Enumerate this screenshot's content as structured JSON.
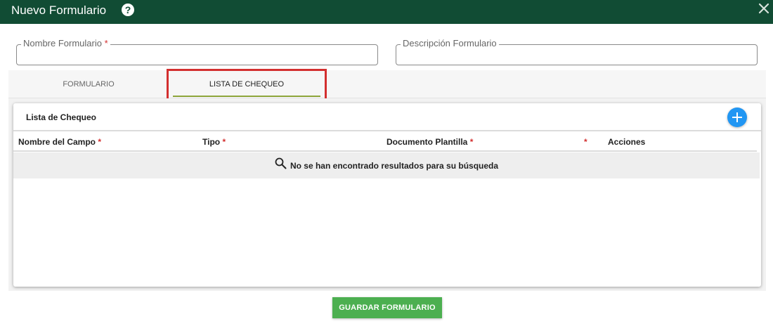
{
  "window": {
    "title": "Nuevo Formulario",
    "help_icon": "help-icon",
    "close_icon": "close-icon"
  },
  "form": {
    "name_field": {
      "label": "Nombre Formulario",
      "required_mark": "*",
      "value": ""
    },
    "description_field": {
      "label": "Descripción Formulario",
      "value": ""
    }
  },
  "tabs": [
    {
      "label": "FORMULARIO",
      "active": false
    },
    {
      "label": "LISTA DE CHEQUEO",
      "active": true
    }
  ],
  "checklist": {
    "title": "Lista de Chequeo",
    "add_icon": "add-icon",
    "columns": [
      {
        "label": "Nombre del Campo",
        "required_mark": "*"
      },
      {
        "label": "Tipo",
        "required_mark": "*"
      },
      {
        "label": "Documento Plantilla",
        "required_mark": "*"
      },
      {
        "label": "",
        "required_mark": "*"
      },
      {
        "label": "Acciones",
        "required_mark": ""
      }
    ],
    "empty_message": "No se han encontrado resultados para su búsqueda",
    "empty_icon": "search-icon"
  },
  "footer": {
    "save_label": "GUARDAR FORMULARIO"
  },
  "colors": {
    "header_bg": "#114c34",
    "required": "#d32f2f",
    "add_button": "#2196f3",
    "save_button": "#4caf50",
    "highlight": "#d32f2f",
    "tab_underline": "#8da53a"
  }
}
